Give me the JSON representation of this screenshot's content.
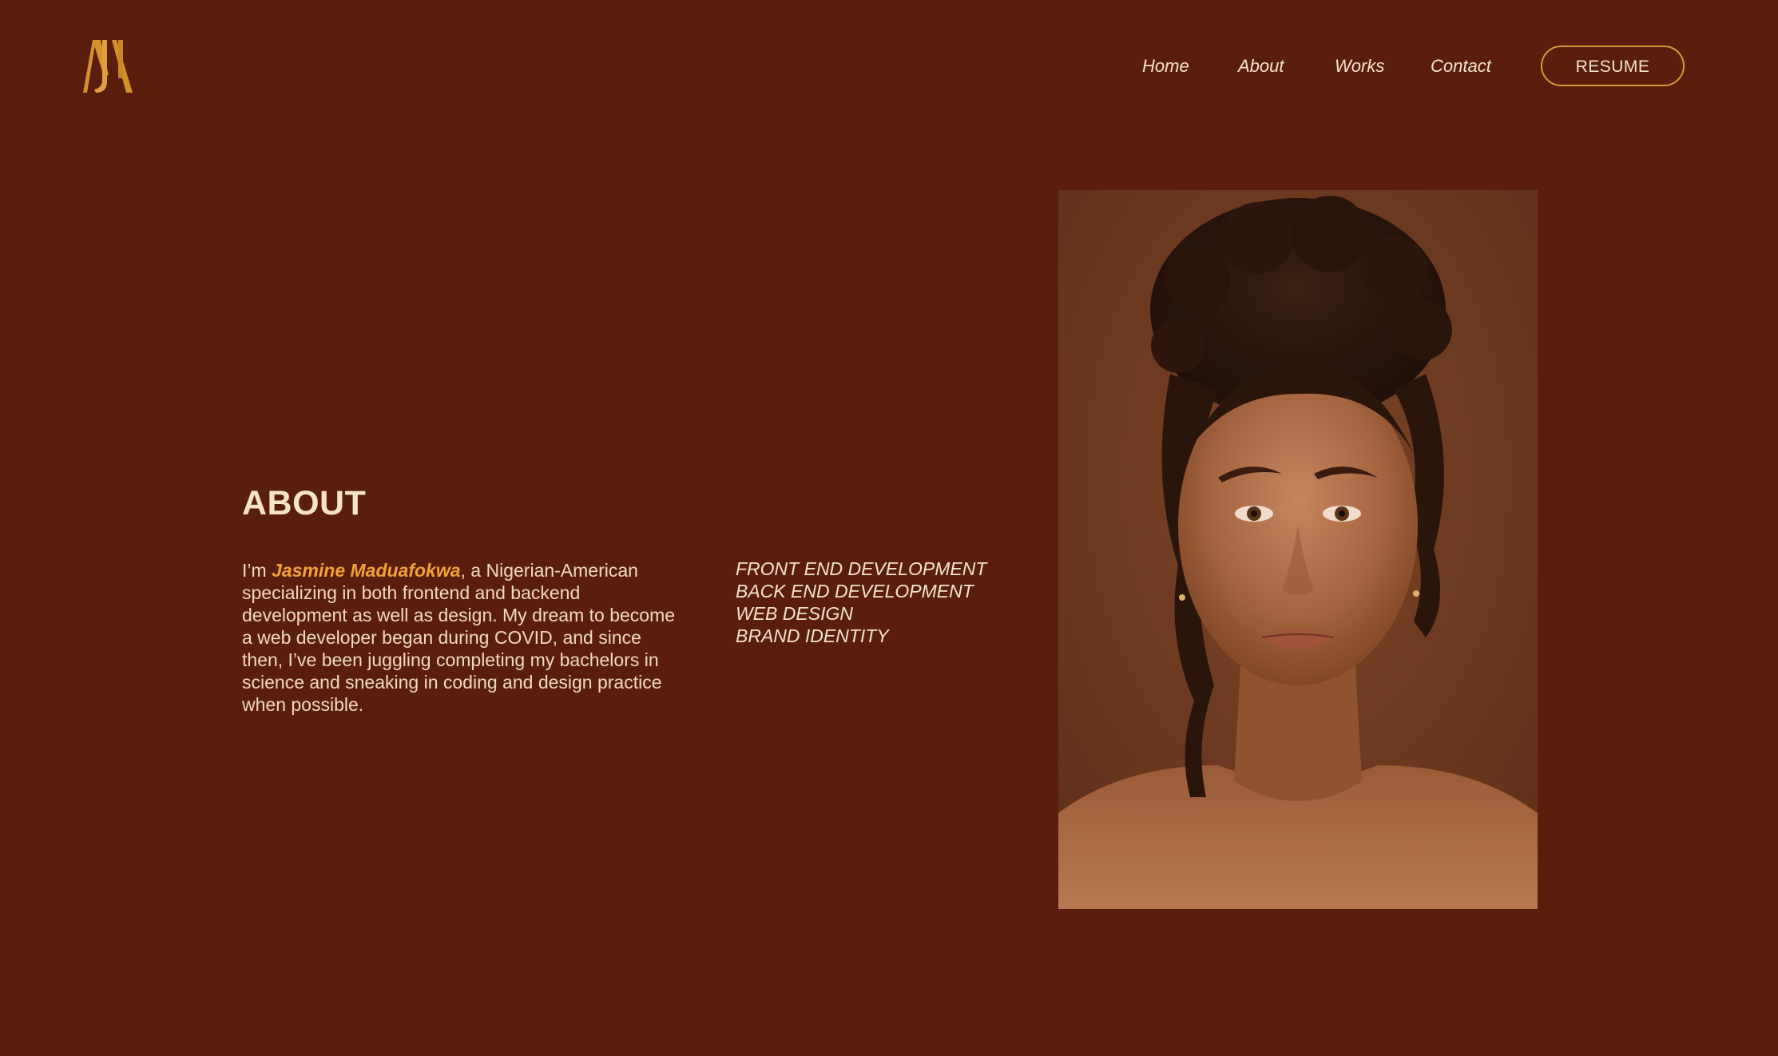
{
  "logo": {
    "icon": "jm-monogram-icon",
    "color": "#d4922e"
  },
  "nav": {
    "items": [
      {
        "label": "Home"
      },
      {
        "label": "About"
      },
      {
        "label": "Works"
      },
      {
        "label": "Contact"
      }
    ],
    "resume_label": "RESUME"
  },
  "about": {
    "heading": "ABOUT",
    "bio_prefix": "I’m ",
    "bio_name": "Jasmine Maduafokwa",
    "bio_suffix": ", a Nigerian-American specializing in both frontend and backend development as well as design. My dream to become a web developer began during COVID, and since then, I’ve been juggling completing my bachelors in science and sneaking in coding and design practice when possible.",
    "skills": [
      "FRONT END DEVELOPMENT",
      "BACK END DEVELOPMENT",
      "WEB DESIGN",
      "BRAND IDENTITY"
    ]
  },
  "colors": {
    "background": "#5a1f0c",
    "accent": "#f0a23a",
    "text": "#f3e3cc",
    "button_border": "#d49a3a"
  }
}
